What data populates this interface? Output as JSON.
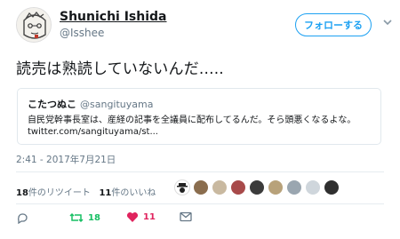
{
  "author": {
    "name": "Shunichi Ishida",
    "handle": "@Isshee"
  },
  "follow_label": "フォローする",
  "tweet_text": "読売は熟読していないんだ.....",
  "quoted": {
    "name": "こたつぬこ",
    "handle": "@sangituyama",
    "text": "自民党幹事長室は、産経の記事を全議員に配布してるんだ。そら頭悪くなるよな。",
    "link": "twitter.com/sangituyama/st..."
  },
  "timestamp": "2:41 - 2017年7月21日",
  "stats": {
    "retweets_count": "18",
    "retweets_label": "件のリツイート",
    "likes_count": "11",
    "likes_label": "件のいいね"
  },
  "actions": {
    "retweet_count": "18",
    "like_count": "11"
  },
  "colors": {
    "accent": "#1da1f2",
    "retweet": "#17bf63",
    "like": "#e0245e",
    "muted": "#657786"
  },
  "icons": [
    "reply-icon",
    "retweet-icon",
    "heart-icon",
    "message-icon",
    "chevron-down-icon"
  ]
}
